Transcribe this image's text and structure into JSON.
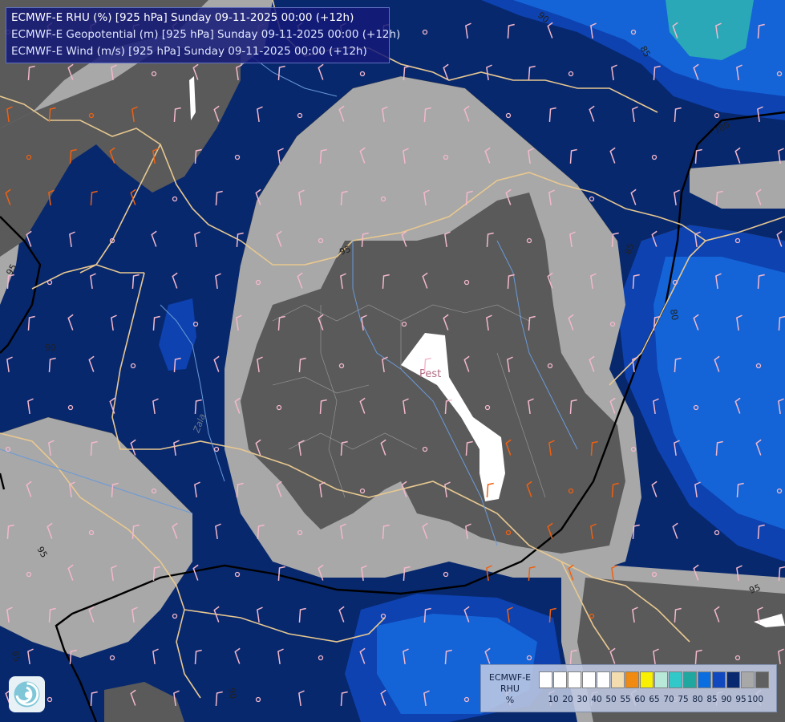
{
  "title": {
    "line1": "ECMWF-E RHU (%) [925 hPa] Sunday 09-11-2025 00:00 (+12h)",
    "line2": "ECMWF-E Geopotential (m) [925 hPa] Sunday 09-11-2025 00:00 (+12h)",
    "line3": "ECMWF-E Wind (m/s) [925 hPa] Sunday 09-11-2025 00:00 (+12h)"
  },
  "legend": {
    "model": "ECMWF-E",
    "variable": "RHU",
    "unit": "%",
    "ticks": [
      "10",
      "20",
      "30",
      "40",
      "50",
      "55",
      "60",
      "65",
      "70",
      "75",
      "80",
      "85",
      "90",
      "95",
      "100"
    ],
    "colors": [
      "#ffffff",
      "#ffffff",
      "#ffffff",
      "#ffffff",
      "#ffffff",
      "#f2dcb0",
      "#f08a10",
      "#f8f000",
      "#b8e8d8",
      "#30c8c8",
      "#20a8a0",
      "#0a6ee0",
      "#1048c0",
      "#082870",
      "#a8a8a8",
      "#606060"
    ]
  },
  "map": {
    "city_label": "Pest",
    "river_label": "Zala",
    "contours_rhu": [
      "95",
      "95",
      "90",
      "85",
      "80",
      "85",
      "90",
      "95",
      "95",
      "90",
      "85"
    ],
    "contours_geopotential": [
      "780"
    ],
    "colors": {
      "rhu_100": "#5a5a5a",
      "rhu_95": "#a8a8a8",
      "rhu_90": "#08286e",
      "rhu_85": "#0d42b0",
      "rhu_80": "#1464d8",
      "rhu_75": "#2aa8b8",
      "borders": "#e8c890",
      "rivers": "#6a9ad8",
      "wind_low": "#f4b8cc",
      "wind_mid": "#f06010",
      "wind_high": "#c01010"
    }
  }
}
